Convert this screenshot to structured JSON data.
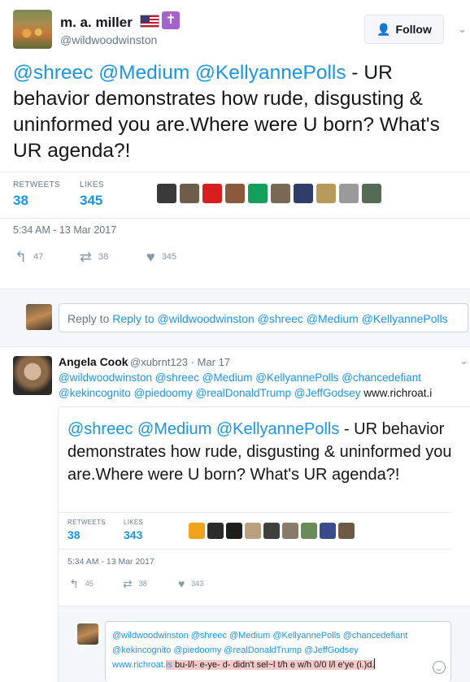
{
  "author": {
    "name": "m. a. miller",
    "handle": "@wildwoodwinston",
    "badges": [
      "us-flag-icon",
      "latin-cross-icon"
    ]
  },
  "follow_label": "Follow",
  "tweet": {
    "mentions": "@shreec @Medium @KellyannePolls",
    "text": " - UR behavior demonstrates how rude, disgusting & uninformed you are.Where were U born? What's UR agenda?!",
    "retweets_label": "RETWEETS",
    "retweets": "38",
    "likes_label": "LIKES",
    "likes": "345",
    "timestamp": "5:34 AM - 13 Mar 2017",
    "actions": {
      "reply": "47",
      "retweet": "38",
      "like": "345"
    }
  },
  "reply_prompt": "Reply to @wildwoodwinston @shreec @Medium @KellyannePolls",
  "reply": {
    "name": "Angela Cook",
    "handle_date": "@xubrnt123 · Mar 17",
    "line1": "@wildwoodwinston @shreec @Medium @KellyannePolls  @chancedefiant",
    "line2_mentions": "@kekincognito @piedoomy @realDonaldTrump @JeffGodsey",
    "line2_link": " www.richroat.i"
  },
  "quoted": {
    "mentions": "@shreec @Medium @KellyannePolls",
    "text": " - UR behavior demonstrates how rude, disgusting & uninformed you are.Where were U born? What's UR agenda?!",
    "retweets_label": "RETWEETS",
    "retweets": "38",
    "likes_label": "LIKES",
    "likes": "343",
    "timestamp": "5:34 AM - 13 Mar 2017",
    "actions": {
      "reply": "45",
      "retweet": "38",
      "like": "343"
    }
  },
  "compose": {
    "line1": "@wildwoodwinston @shreec @Medium @KellyannePolls  @chancedefiant",
    "line2": "@kekincognito @piedoomy @realDonaldTrump @JeffGodsey",
    "line3_link": "www.richroat.",
    "line3_hl_link": "is",
    "line3_hl_text": " bu-l/l- e-ye- d- didn't sel~l t/h e w/h 0/0 l/l e'ye (i.)d."
  },
  "colors": {
    "accent": "#1b95e0",
    "muted": "#657786",
    "band": "#f5f8fa",
    "highlight": "#f6c9c9"
  },
  "likers_main": [
    "#3a3a3a",
    "#6d5d4a",
    "#d62020",
    "#8a5a3c",
    "#14a05b",
    "#7a6a55",
    "#2e3e68",
    "#b59a5a",
    "#9a9a9a",
    "#556b55"
  ],
  "likers_quoted": [
    "#f1a21c",
    "#2b2b2b",
    "#1d1d1d",
    "#b9a07e",
    "#3f3f3f",
    "#8a7a6a",
    "#6a8a5a",
    "#3a4b8c",
    "#6e5a44"
  ]
}
